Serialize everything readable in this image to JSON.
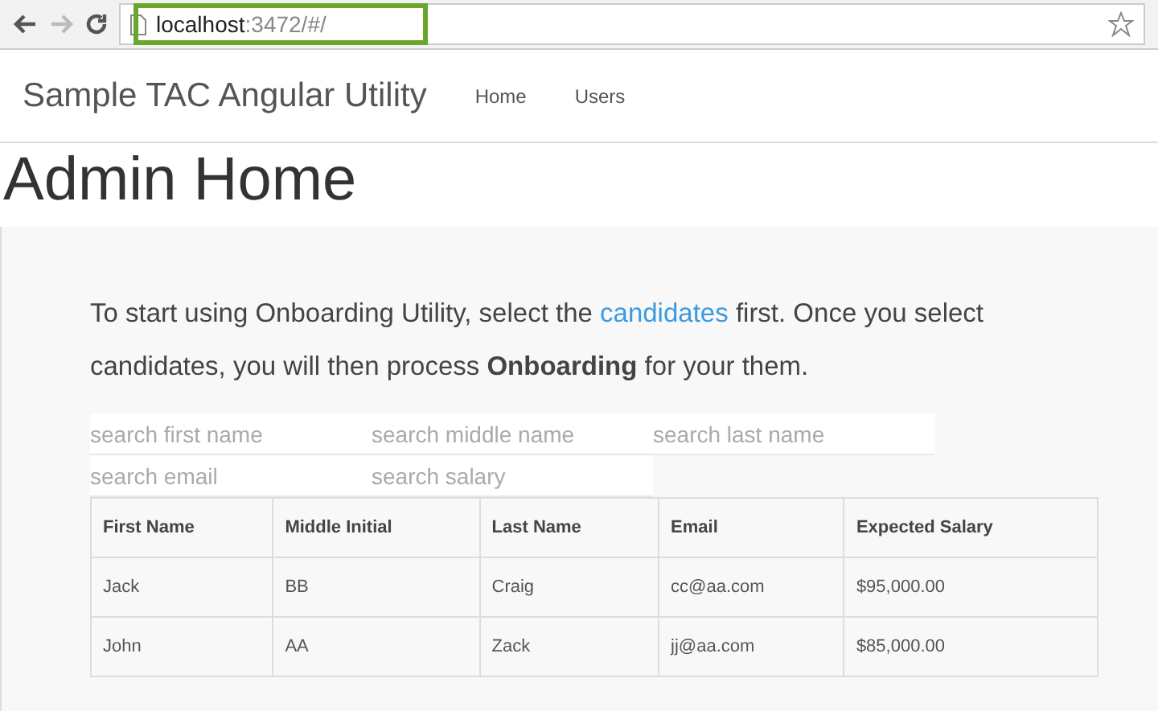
{
  "browser": {
    "url_host": "localhost",
    "url_path": ":3472/#/",
    "highlighted": true
  },
  "navbar": {
    "brand": "Sample TAC Angular Utility",
    "links": [
      "Home",
      "Users"
    ]
  },
  "page_title": "Admin Home",
  "intro": {
    "before": "To start using Onboarding Utility, select the",
    "link": "candidates",
    "after": "first. Once you select candidates, you will then process **Onboarding** for your them."
  },
  "search_fields": [
    {
      "placeholder": "search first name"
    },
    {
      "placeholder": "search middle name"
    },
    {
      "placeholder": "search last name"
    },
    {
      "placeholder": "search email"
    },
    {
      "placeholder": "search salary"
    }
  ],
  "table": {
    "columns": [
      "First Name",
      "Middle Initial",
      "Last Name",
      "Email",
      "Expected Salary"
    ],
    "rows": [
      [
        "Jack",
        "BB",
        "Craig",
        "cc@aa.com",
        "$95,000.00"
      ],
      [
        "John",
        "AA",
        "Zack",
        "jj@aa.com",
        "$85,000.00"
      ]
    ]
  }
}
